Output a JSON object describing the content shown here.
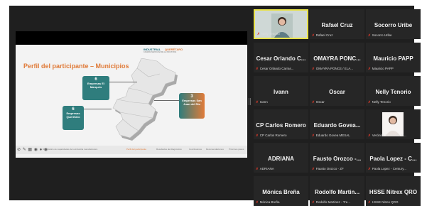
{
  "slide": {
    "title": "Perfil del participante – Municipios",
    "brand_left": "INDUSTRIAL",
    "brand_right": "QUERÉTARO",
    "brand_sub": "CÁMARA MEXICANA DE LA INDUSTRIA",
    "cards": [
      {
        "num": "6",
        "label": "Empresas El Marqués"
      },
      {
        "num": "6",
        "label": "Empresas Querétaro"
      },
      {
        "num": "3",
        "label": "Empresas San Juan del Río"
      }
    ],
    "tabs": [
      "Perfil del participante",
      "Resultados del diagnóstico",
      "Conclusiones",
      "Recomendaciones",
      "Próximos pasos"
    ],
    "active_tab": "Perfil del participante",
    "footer_text": "Diagnóstico de capacidades de la industria manufacturera"
  },
  "participants": [
    {
      "name": "",
      "label": "Nelly Tenorio",
      "video": true
    },
    {
      "name": "Rafael Cruz",
      "label": "Rafael Cruz"
    },
    {
      "name": "Socorro Uribe",
      "label": "Socorro Uribe"
    },
    {
      "name": "Cesar Orlando C...",
      "label": "Cesar Orlando Carras..."
    },
    {
      "name": "OMAYRA PONC...",
      "label": "OMAYRA PONCE / ELA..."
    },
    {
      "name": "Mauricio PAPP",
      "label": "Mauricio PAPP"
    },
    {
      "name": "Ivann",
      "label": "Ivann"
    },
    {
      "name": "Oscar",
      "label": "Oscar"
    },
    {
      "name": "Nelly Tenorio",
      "label": "Nelly Tenorio"
    },
    {
      "name": "CP Carlos Romero",
      "label": "CP Carlos Romero"
    },
    {
      "name": "Eduardo Govea...",
      "label": "Eduardo Govea MESAL"
    },
    {
      "name": "",
      "label": "Verónica Loera villa M...",
      "video": true
    },
    {
      "name": "ADRIANA",
      "label": "ADRIANA"
    },
    {
      "name": "Fausto Orozco -...",
      "label": "Fausto Orozco - ZF"
    },
    {
      "name": "Paola Lopez - C...",
      "label": "Paola Lopez - Century..."
    },
    {
      "name": "Mónica Breña",
      "label": "Mónica Breña"
    },
    {
      "name": "Rodolfo Martin...",
      "label": "Rodolfo Martinez - Tre..."
    },
    {
      "name": "HSSE Nitrex QRO",
      "label": "HSSE Nitrex QRO"
    }
  ],
  "colors": {
    "accent": "#e07b39",
    "teal": "#2f7d7d",
    "active_speaker": "#e8e14a",
    "muted_mic": "#e03b2a"
  },
  "icons": {
    "mic": "muted-mic-icon"
  }
}
